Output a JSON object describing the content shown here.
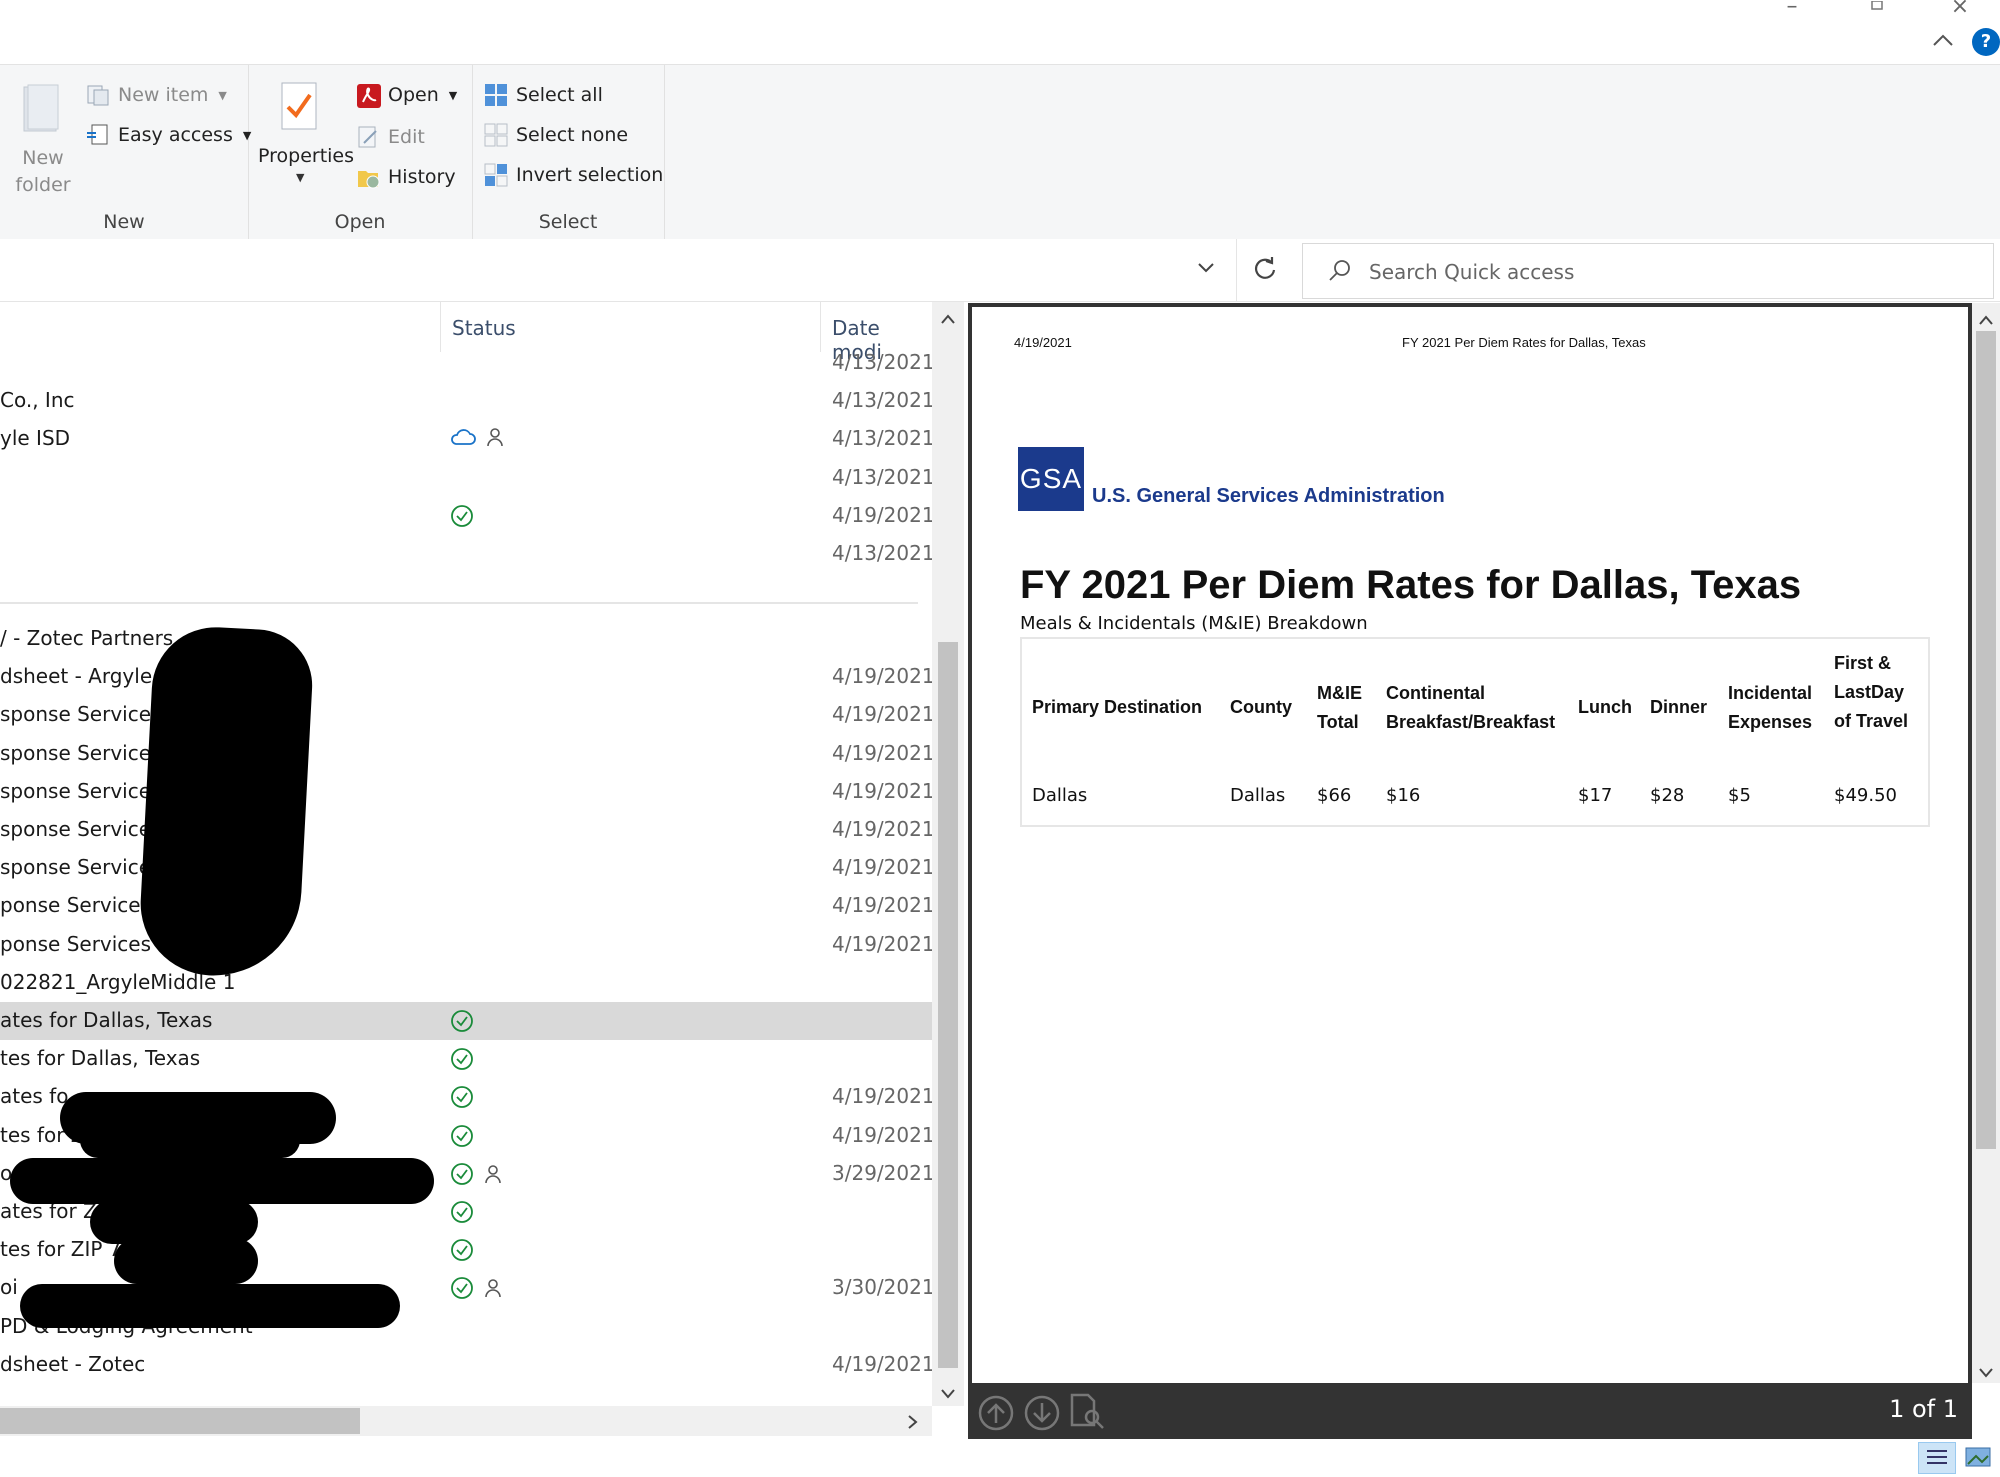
{
  "ribbon": {
    "groups": {
      "new": {
        "label": "New",
        "new_folder": "New\nfolder",
        "new_item": "New item",
        "easy_access": "Easy access"
      },
      "open": {
        "label": "Open",
        "properties": "Properties",
        "open": "Open",
        "edit": "Edit",
        "history": "History"
      },
      "select": {
        "label": "Select",
        "select_all": "Select all",
        "select_none": "Select none",
        "invert_selection": "Invert selection"
      }
    }
  },
  "search": {
    "placeholder": "Search Quick access"
  },
  "filelist": {
    "columns": {
      "status": "Status",
      "date": "Date modi"
    },
    "rows_top": [
      {
        "name": "",
        "date": "4/13/2021",
        "status": []
      },
      {
        "name": "Co., Inc",
        "date": "4/13/2021",
        "status": []
      },
      {
        "name": "yle ISD",
        "date": "4/13/2021",
        "status": [
          "cloud",
          "person"
        ]
      },
      {
        "name": "",
        "date": "4/13/2021",
        "status": []
      },
      {
        "name": "",
        "date": "4/19/2021",
        "status": [
          "check"
        ]
      },
      {
        "name": "",
        "date": "4/13/2021",
        "status": []
      }
    ],
    "rows_bottom": [
      {
        "name": "/ - Zotec Partners",
        "date": "",
        "status": []
      },
      {
        "name": "dsheet - Argyle",
        "date": "4/19/2021",
        "status": []
      },
      {
        "name": "sponse Services",
        "date": "4/19/2021",
        "status": []
      },
      {
        "name": "sponse Services",
        "date": "4/19/2021",
        "status": []
      },
      {
        "name": "sponse Services",
        "date": "4/19/2021",
        "status": []
      },
      {
        "name": "sponse Services",
        "date": "4/19/2021",
        "status": []
      },
      {
        "name": "sponse Services",
        "date": "4/19/2021",
        "status": []
      },
      {
        "name": "ponse Services -",
        "date": "4/19/2021",
        "status": []
      },
      {
        "name": "ponse Services -",
        "date": "4/19/2021",
        "status": []
      },
      {
        "name": "022821_ArgyleMiddle 1",
        "date": "",
        "status": []
      },
      {
        "name": "ates for Dallas, Texas",
        "date": "",
        "status": [
          "check"
        ],
        "selected": true
      },
      {
        "name": "tes for Dallas, Texas",
        "date": "",
        "status": [
          "check"
        ]
      },
      {
        "name": "ates fo",
        "date": "4/19/2021",
        "status": [
          "check"
        ]
      },
      {
        "name": "tes for Z",
        "date": "4/19/2021",
        "status": [
          "check"
        ]
      },
      {
        "name": "o",
        "date": "3/29/2021",
        "status": [
          "check",
          "person"
        ]
      },
      {
        "name": "ates for ZI",
        "date": "",
        "status": [
          "check"
        ]
      },
      {
        "name": "tes for ZIP 7",
        "date": "",
        "status": [
          "check"
        ]
      },
      {
        "name": "oi",
        "date": "3/30/2021",
        "status": [
          "check",
          "person"
        ]
      },
      {
        "name": "PD & Lodging Agreement",
        "date": "",
        "status": []
      },
      {
        "name": "dsheet - Zotec",
        "date": "4/19/2021",
        "status": []
      }
    ]
  },
  "preview": {
    "header_date": "4/19/2021",
    "header_title": "FY 2021 Per Diem Rates for Dallas, Texas",
    "logo_text": "GSA",
    "agency": "U.S. General Services Administration",
    "title": "FY 2021 Per Diem Rates for Dallas, Texas",
    "subtitle": "Meals & Incidentals (M&IE) Breakdown",
    "table": {
      "headers": [
        "Primary Destination",
        "County",
        "M&IE\nTotal",
        "Continental\nBreakfast/Breakfast",
        "Lunch",
        "Dinner",
        "Incidental\nExpenses",
        "First &\nLastDay\nof Travel"
      ],
      "row": [
        "Dallas",
        "Dallas",
        "$66",
        "$16",
        "$17",
        "$28",
        "$5",
        "$49.50"
      ]
    },
    "page_count": "1 of 1"
  },
  "colors": {
    "gsa_blue": "#1b3a8c",
    "check_green": "#1a8b3a",
    "cloud_blue": "#1a73c8",
    "help_blue": "#0067c0"
  }
}
